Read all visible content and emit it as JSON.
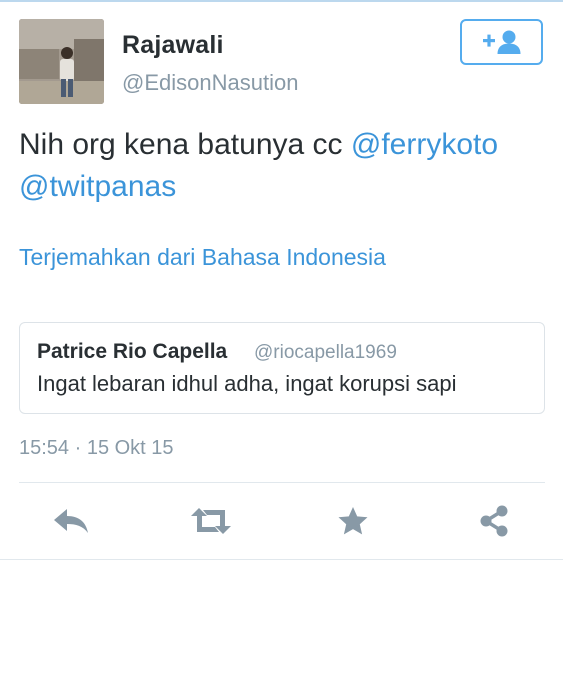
{
  "tweet": {
    "author_name": "Rajawali",
    "author_handle": "@EdisonNasution",
    "text_prefix": "Nih org kena batunya cc ",
    "mentions": [
      "@ferrykoto",
      "@twitpanas"
    ],
    "translate_label": "Terjemahkan dari Bahasa Indonesia",
    "timestamp": "15:54 · 15 Okt 15"
  },
  "quoted": {
    "author_name": "Patrice Rio Capella",
    "author_handle": "@riocapella1969",
    "text": "Ingat lebaran idhul adha, ingat korupsi sapi"
  },
  "actions": {
    "follow_icon": "add-user-icon",
    "reply_icon": "reply-icon",
    "retweet_icon": "retweet-icon",
    "favorite_icon": "star-icon",
    "share_icon": "share-icon"
  },
  "colors": {
    "accent": "#55acee",
    "link": "#3b94d9",
    "text": "#292f33",
    "muted": "#8899a6",
    "icon": "#8899a6"
  }
}
